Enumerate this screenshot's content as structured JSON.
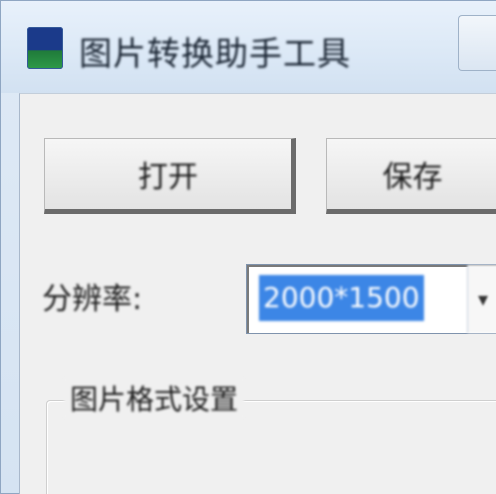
{
  "window": {
    "title": "图片转换助手工具",
    "icon": "app-icon"
  },
  "toolbar": {
    "left_button_label": "打开",
    "right_button_label": "保存"
  },
  "form": {
    "size_label": "分辨率:",
    "size_value": "2000*1500",
    "dropdown_arrow": "▾"
  },
  "group": {
    "title": "图片格式设置"
  }
}
